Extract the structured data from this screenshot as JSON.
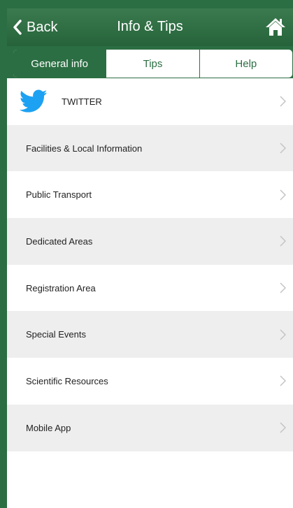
{
  "header": {
    "back_label": "Back",
    "title": "Info & Tips",
    "home_icon": "home-icon",
    "color": "#2c6e43"
  },
  "tabs": [
    {
      "label": "General info",
      "active": true
    },
    {
      "label": "Tips",
      "active": false
    },
    {
      "label": "Help",
      "active": false
    }
  ],
  "items": [
    {
      "label": "TWITTER",
      "icon": "twitter-bird-icon"
    },
    {
      "label": "Facilities & Local Information"
    },
    {
      "label": "Public Transport"
    },
    {
      "label": "Dedicated Areas"
    },
    {
      "label": "Registration Area"
    },
    {
      "label": "Special Events"
    },
    {
      "label": "Scientific Resources"
    },
    {
      "label": "Mobile App"
    }
  ],
  "colors": {
    "brand_green": "#2c6e43",
    "twitter_blue": "#1da1f2",
    "row_alt": "#eeeeee"
  }
}
